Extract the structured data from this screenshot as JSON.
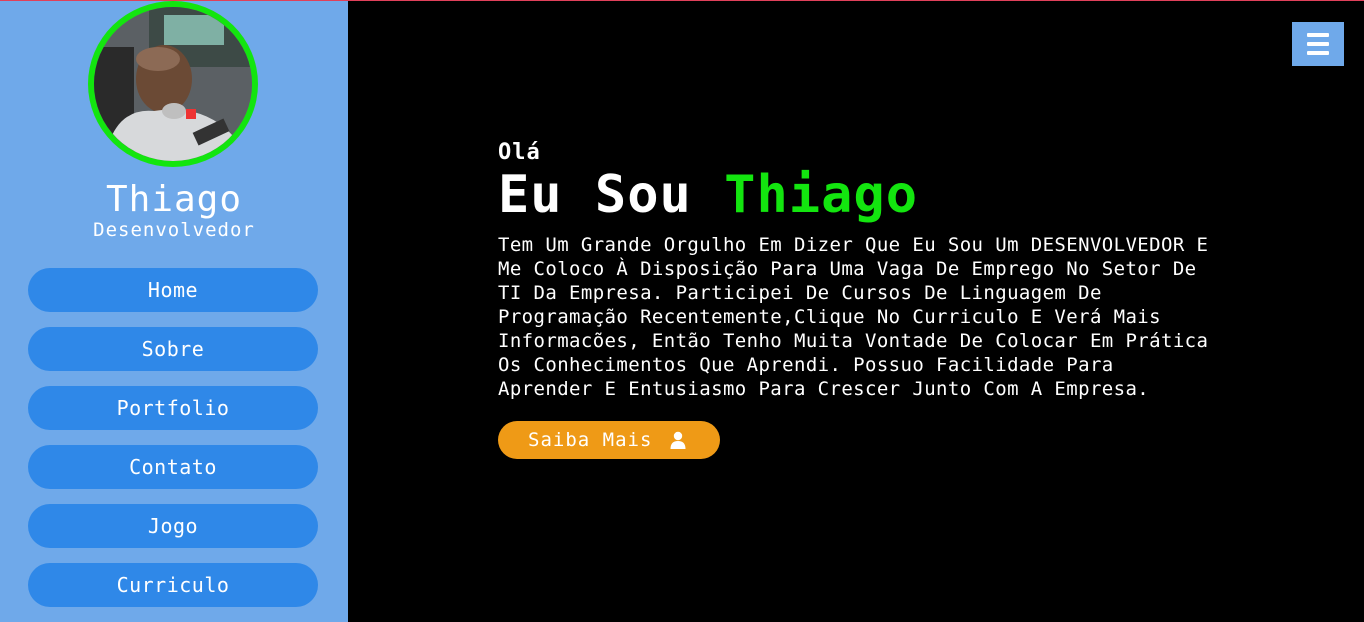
{
  "profile": {
    "name": "Thiago",
    "role": "Desenvolvedor",
    "ring_color": "#13e50f"
  },
  "nav": {
    "items": [
      {
        "label": "Home"
      },
      {
        "label": "Sobre"
      },
      {
        "label": "Portfolio"
      },
      {
        "label": "Contato"
      },
      {
        "label": "Jogo"
      },
      {
        "label": "Curriculo"
      }
    ]
  },
  "menu": {
    "icon": "hamburger-icon"
  },
  "hero": {
    "greeting": "Olá",
    "headline_prefix": "Eu Sou ",
    "headline_name": "Thiago",
    "description": "Tem Um Grande Orgulho Em Dizer Que Eu Sou Um DESENVOLVEDOR E Me Coloco À Disposição Para Uma Vaga De Emprego No Setor De TI Da Empresa. Participei De Cursos De Linguagem De Programação Recentemente,Clique No Curriculo E Verá Mais Informacões, Então Tenho Muita Vontade De Colocar Em Prática Os Conhecimentos Que Aprendi. Possuo Facilidade Para Aprender E Entusiasmo Para Crescer Junto Com A Empresa.",
    "cta_label": "Saiba Mais",
    "cta_icon": "user-icon"
  },
  "colors": {
    "sidebar": "#6fa9ea",
    "nav_button": "#2f88e8",
    "accent_green": "#13e50f",
    "cta": "#ef9a16",
    "background": "#000000"
  }
}
